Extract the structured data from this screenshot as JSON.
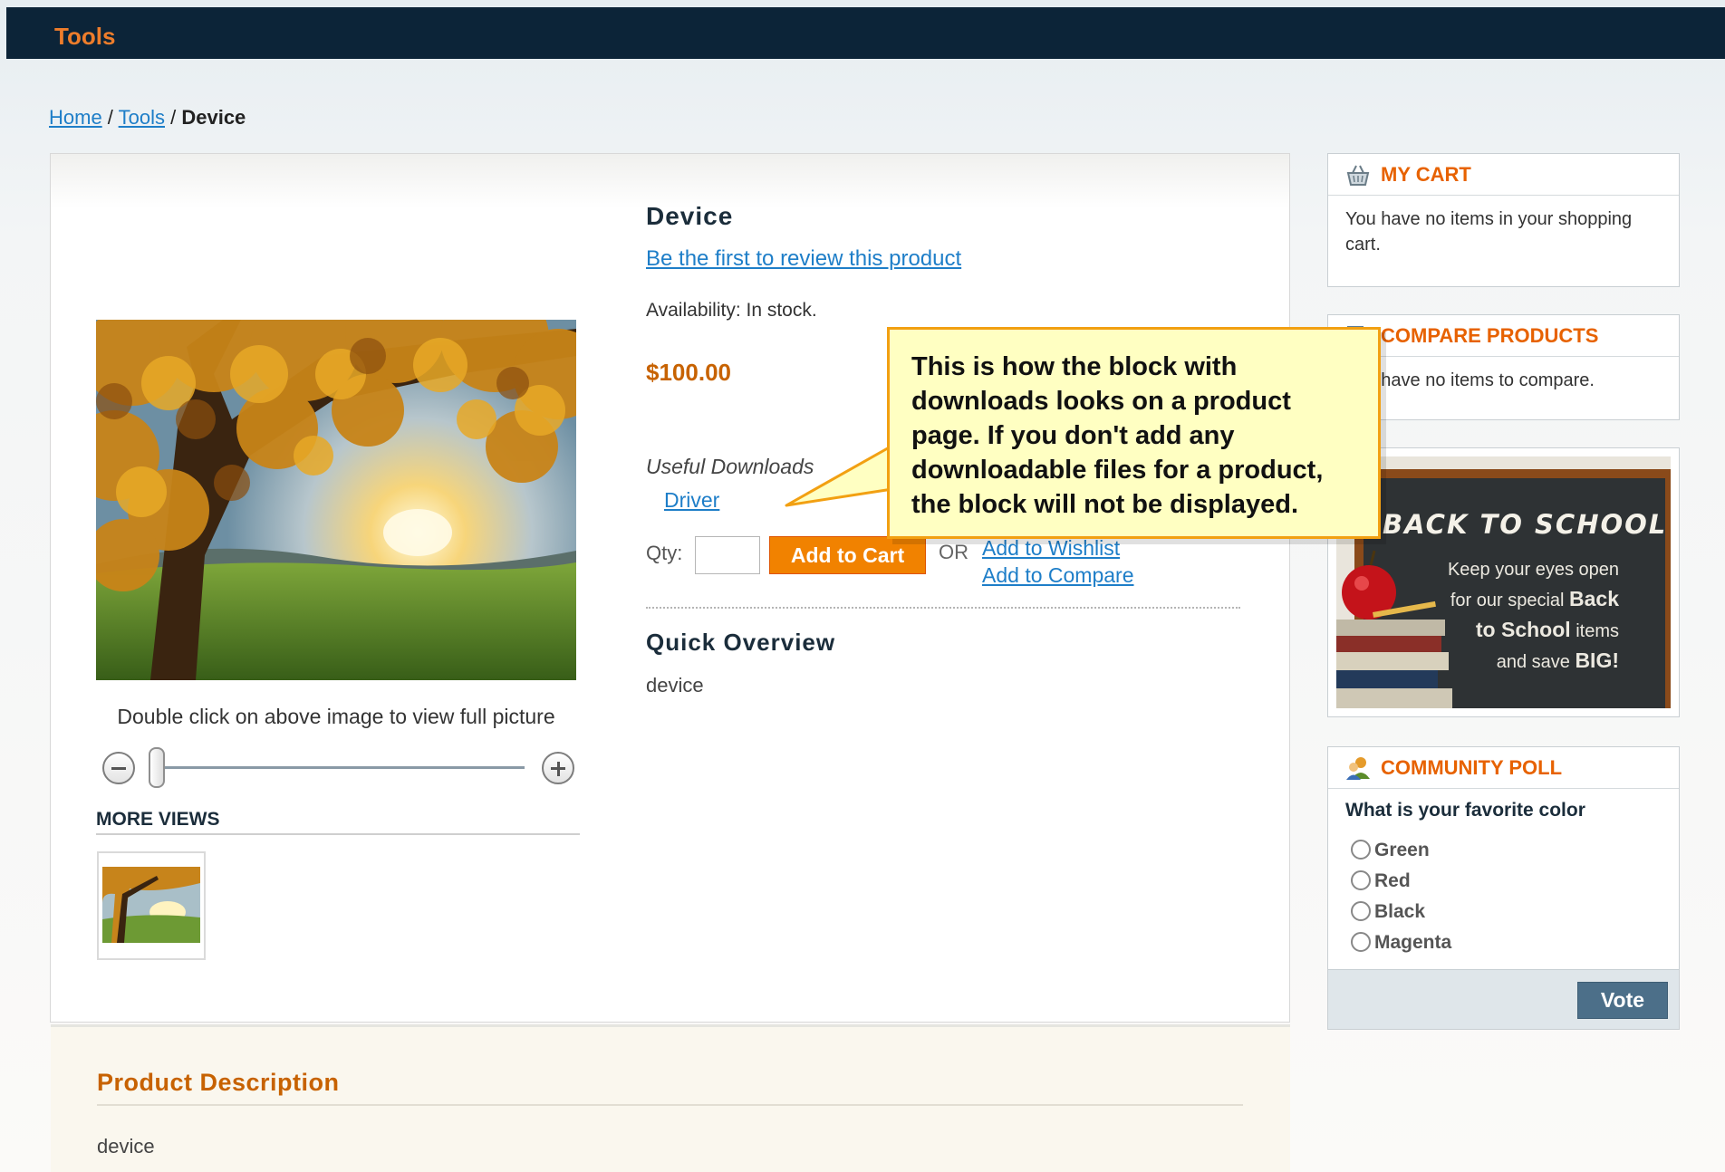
{
  "header": {
    "nav_tools": "Tools"
  },
  "breadcrumb": {
    "home": "Home",
    "separator": " / ",
    "tools": "Tools",
    "current": "Device"
  },
  "product": {
    "name": "Device",
    "review_link": "Be the first to review this product",
    "availability": "Availability: In stock.",
    "price": "$100.00",
    "downloads_title": "Useful Downloads",
    "downloads": [
      "Driver"
    ],
    "qty_label": "Qty:",
    "qty_value": "",
    "add_to_cart": "Add to Cart",
    "or_label": "OR",
    "add_to_wishlist": "Add to Wishlist",
    "add_to_compare": "Add to Compare",
    "overview_title": "Quick Overview",
    "overview_text": "device",
    "zoom_hint": "Double click on above image to view full picture",
    "zoom_level": 0,
    "more_views_title": "MORE VIEWS",
    "description_title": "Product Description",
    "description_text": "device"
  },
  "sidebar": {
    "cart": {
      "title": "MY CART",
      "text": "You have no items in your shopping cart."
    },
    "compare": {
      "title": "COMPARE PRODUCTS",
      "text": "You have no items to compare."
    },
    "banner": {
      "heading": "BACK TO SCHOOL",
      "line1": "Keep your eyes open",
      "line2_prefix": "for our special ",
      "line2_strong": "Back",
      "line3_strong": "to School",
      "line3_suffix": " items",
      "line4_prefix": "and save ",
      "line4_strong": "BIG!"
    },
    "poll": {
      "title": "COMMUNITY POLL",
      "question": "What is your favorite color",
      "options": [
        "Green",
        "Red",
        "Black",
        "Magenta"
      ],
      "vote_button": "Vote"
    }
  },
  "callout": {
    "text": "This is how the block with downloads looks on a product page. If you don't add any downloadable files for a product, the block will not be displayed."
  },
  "colors": {
    "header_bg": "#0c2438",
    "accent_orange": "#f18200",
    "link_blue": "#1e7ec8",
    "callout_bg": "#ffffc2",
    "callout_border": "#f2a012"
  },
  "icons": {
    "cart": "shopping-basket-icon",
    "compare": "compare-icon",
    "poll": "users-icon",
    "zoom_out": "zoom-out-icon",
    "zoom_in": "zoom-in-icon"
  }
}
